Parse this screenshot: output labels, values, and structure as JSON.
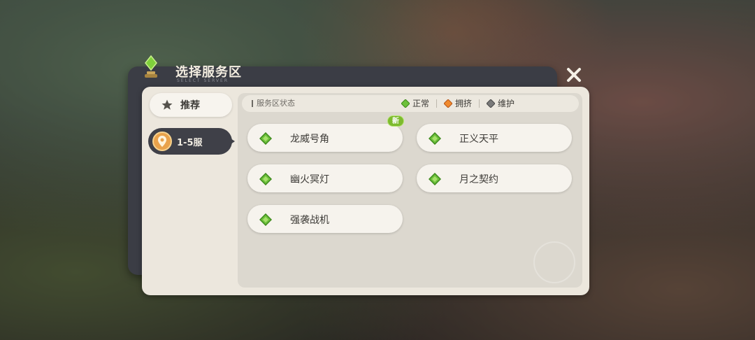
{
  "dialog": {
    "title": "选择服务区",
    "title_sub": "SELECT SERVER"
  },
  "sidebar": {
    "tabs": [
      {
        "label": "推荐",
        "icon": "star-icon",
        "selected": false
      },
      {
        "label": "1-5服",
        "icon": "location-pin-icon",
        "selected": true
      }
    ]
  },
  "status_bar": {
    "title": "服务区状态",
    "legend": [
      {
        "label": "正常",
        "icon": "green-gem-icon",
        "color": "#6cc03a"
      },
      {
        "label": "拥挤",
        "icon": "orange-gem-icon",
        "color": "#f08a2e"
      },
      {
        "label": "维护",
        "icon": "gray-gem-icon",
        "color": "#7a7a7a"
      }
    ]
  },
  "servers": [
    {
      "name": "龙威号角",
      "status": "正常",
      "badge": "新"
    },
    {
      "name": "正义天平",
      "status": "正常",
      "badge": ""
    },
    {
      "name": "幽火冥灯",
      "status": "正常",
      "badge": ""
    },
    {
      "name": "月之契约",
      "status": "正常",
      "badge": ""
    },
    {
      "name": "强袭战机",
      "status": "正常",
      "badge": ""
    }
  ],
  "colors": {
    "panel": "#ece7dd",
    "content": "#dcd8cf",
    "selected_tab": "#3f4048",
    "status_normal": "#6cc03a",
    "status_busy": "#f08a2e",
    "status_maintenance": "#7a7a7a"
  }
}
